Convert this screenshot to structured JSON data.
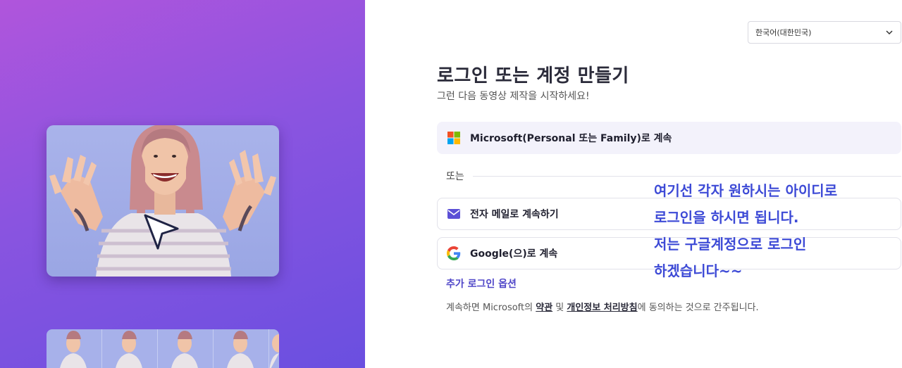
{
  "left_panel": {
    "hero_image": "person-waving-video-preview",
    "cursor_icon": "navigation-arrow-icon",
    "thumbnails_count": 5
  },
  "language_select": {
    "value": "한국어(대한민국)",
    "icon": "chevron-down-icon"
  },
  "header": {
    "title": "로그인 또는 계정 만들기",
    "subtitle": "그런 다음 동영상 제작을 시작하세요!"
  },
  "buttons": {
    "microsoft": "Microsoft(Personal 또는 Family)로 계속",
    "email": "전자 메일로 계속하기",
    "google": "Google(으)로 계속"
  },
  "divider": {
    "text": "또는"
  },
  "more_options": "추가 로그인 옵션",
  "terms": {
    "prefix": "계속하면 Microsoft의 ",
    "terms_link": "약관",
    "middle": " 및 ",
    "privacy_link": "개인정보 처리방침",
    "suffix": "에 동의하는 것으로 간주됩니다."
  },
  "annotation": {
    "line1": "여기선 각자 원하시는 아이디로",
    "line2": "로그인을 하시면 됩니다.",
    "line3": "저는 구글계정으로 로그인",
    "line4": "하겠습니다~~"
  },
  "colors": {
    "accent": "#4f46c8",
    "annotation": "#3d4ad6",
    "panel_start": "#b055dc",
    "panel_end": "#6a4fe0"
  }
}
